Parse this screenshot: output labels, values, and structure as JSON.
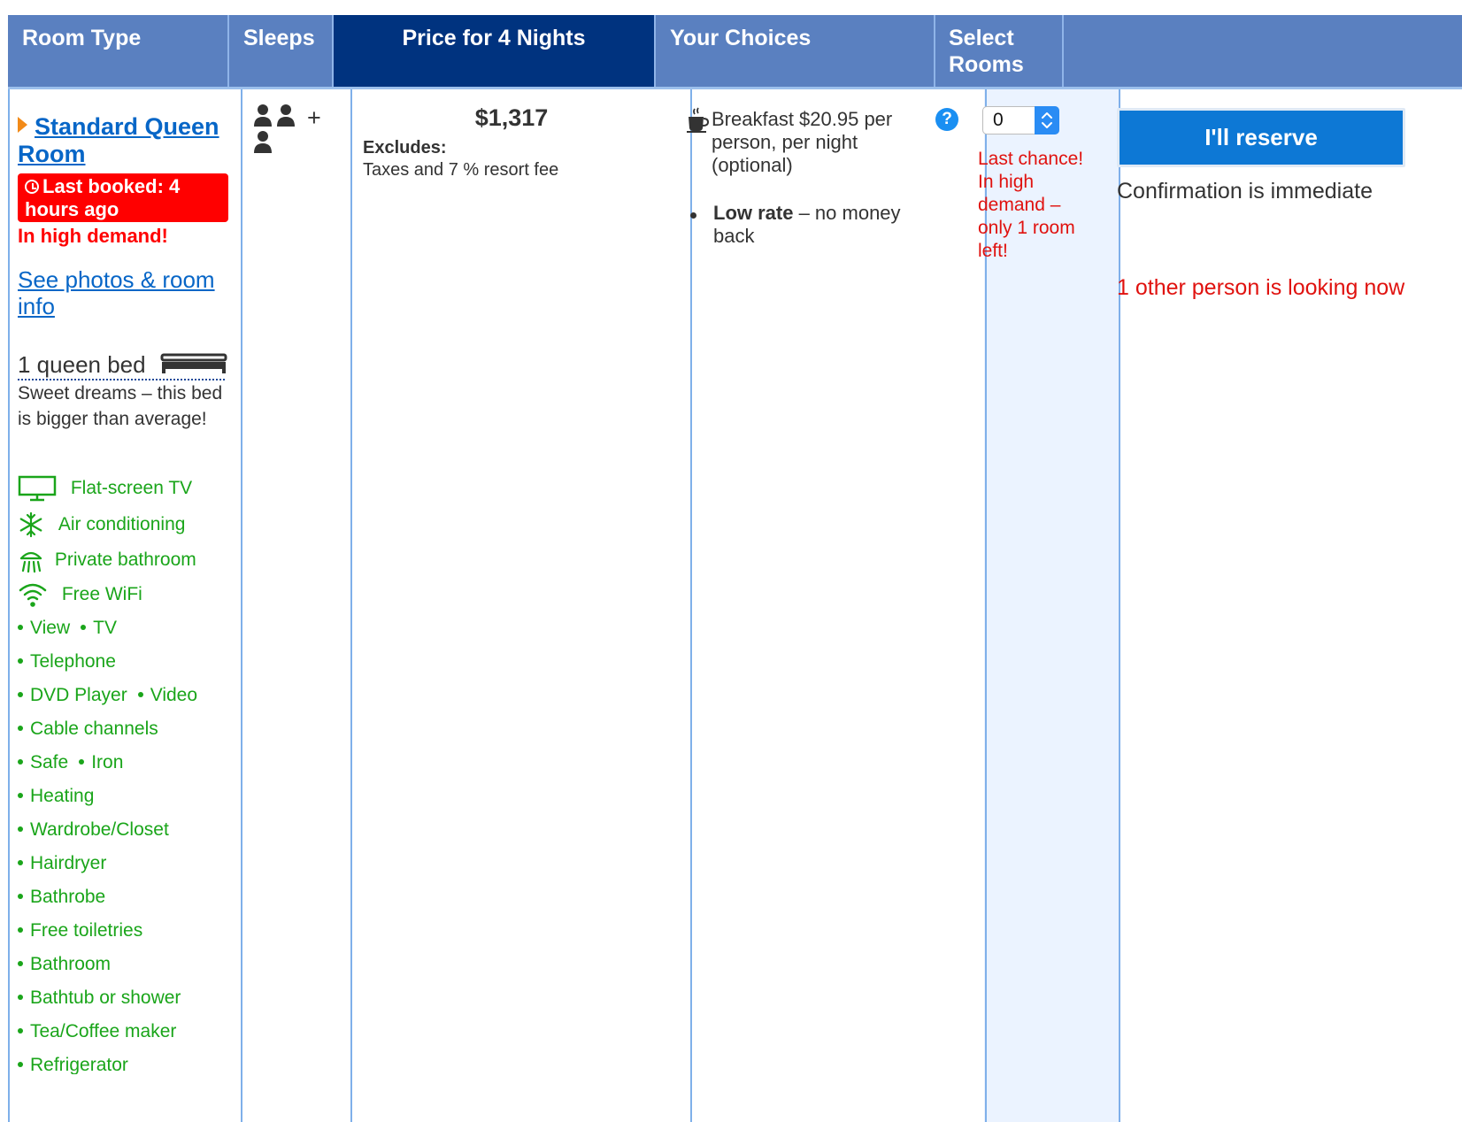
{
  "header": {
    "room_type": "Room Type",
    "sleeps": "Sleeps",
    "price": "Price for 4 Nights",
    "choices": "Your Choices",
    "select_rooms_line1": "Select",
    "select_rooms_line2": "Rooms"
  },
  "room": {
    "title": "Standard Queen Room",
    "last_booked": "Last booked: 4 hours ago",
    "demand": "In high demand!",
    "photos_link": "See photos & room info",
    "bed": "1 queen bed",
    "bed_desc": "Sweet dreams – this bed is bigger than average!",
    "facilities_icons": [
      {
        "label": "Flat-screen TV",
        "icon": "tv-icon"
      },
      {
        "label": "Air conditioning",
        "icon": "snowflake-icon"
      },
      {
        "label": "Private bathroom",
        "icon": "shower-icon"
      },
      {
        "label": "Free WiFi",
        "icon": "wifi-icon"
      }
    ],
    "amenities": [
      "View",
      "TV",
      "Telephone",
      "DVD Player",
      "Video",
      "Cable channels",
      "Safe",
      "Iron",
      "Heating",
      "Wardrobe/Closet",
      "Hairdryer",
      "Bathrobe",
      "Free toiletries",
      "Bathroom",
      "Bathtub or shower",
      "Tea/Coffee maker",
      "Refrigerator"
    ]
  },
  "sleeps": {
    "plus": "+"
  },
  "price": {
    "amount": "$1,317",
    "excludes_label": "Excludes:",
    "excludes_text": "Taxes and 7 % resort fee"
  },
  "choices": {
    "breakfast": "Breakfast $20.95 per person, per night (optional)",
    "help": "?",
    "rate_bold": "Low rate",
    "rate_rest": " – no money back"
  },
  "select": {
    "value": "0",
    "last_chance": "Last chance! In high demand – only 1 room left!"
  },
  "reserve": {
    "button": "I'll reserve",
    "confirmation": "Confirmation is immediate",
    "looking": "1 other person is looking now"
  },
  "colors": {
    "header_bg": "#5a80c0",
    "header_active": "#00337f",
    "link": "#0766c7",
    "amenity_green": "#1aa51a",
    "alert_red": "#ff0000",
    "reserve_blue": "#0d78d5"
  }
}
